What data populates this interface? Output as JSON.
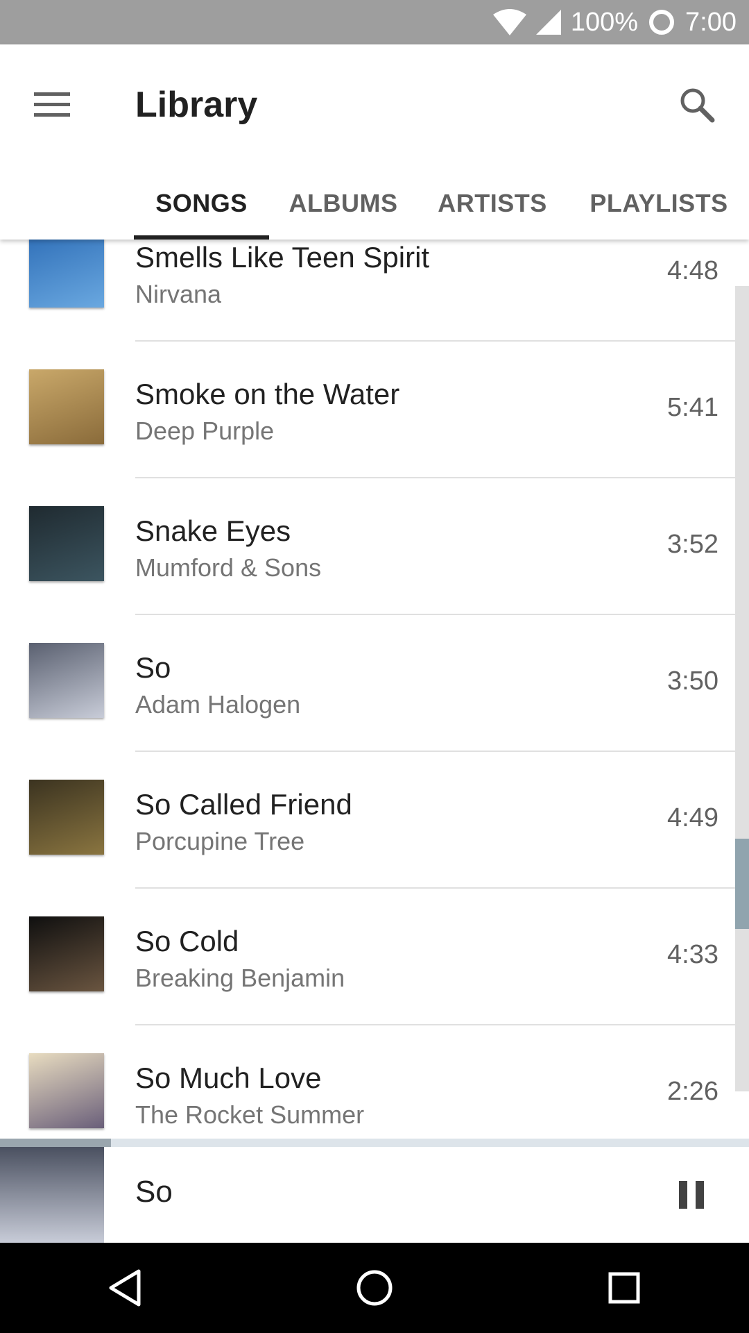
{
  "status_bar": {
    "battery_text": "100%",
    "time": "7:00"
  },
  "app_bar": {
    "title": "Library"
  },
  "tabs": [
    {
      "label": "SONGS",
      "active": true
    },
    {
      "label": "ALBUMS",
      "active": false
    },
    {
      "label": "ARTISTS",
      "active": false
    },
    {
      "label": "PLAYLISTS",
      "active": false
    }
  ],
  "songs": [
    {
      "title": "Smells Like Teen Spirit",
      "artist": "Nirvana",
      "duration": "4:48",
      "art_colors": [
        "#2f6fb8",
        "#6aa8e0"
      ]
    },
    {
      "title": "Smoke on the Water",
      "artist": "Deep Purple",
      "duration": "5:41",
      "art_colors": [
        "#c9a86a",
        "#8a6b3a"
      ]
    },
    {
      "title": "Snake Eyes",
      "artist": "Mumford & Sons",
      "duration": "3:52",
      "art_colors": [
        "#1f2a30",
        "#3c5560"
      ]
    },
    {
      "title": "So",
      "artist": "Adam Halogen",
      "duration": "3:50",
      "art_colors": [
        "#5a6070",
        "#c8ccd8"
      ]
    },
    {
      "title": "So Called Friend",
      "artist": "Porcupine Tree",
      "duration": "4:49",
      "art_colors": [
        "#3b3320",
        "#8a7540"
      ]
    },
    {
      "title": "So Cold",
      "artist": "Breaking Benjamin",
      "duration": "4:33",
      "art_colors": [
        "#0f0f0f",
        "#6a5540"
      ]
    },
    {
      "title": "So Much Love",
      "artist": "The Rocket Summer",
      "duration": "2:26",
      "art_colors": [
        "#e8dcc0",
        "#6a5f7a"
      ]
    }
  ],
  "now_playing": {
    "title": "So",
    "art_colors": [
      "#4a5060",
      "#c8ccd8"
    ]
  },
  "colors": {
    "status_bar": "#9e9e9e",
    "scroll_thumb": "#90a4ae",
    "accent_text": "#212121"
  }
}
